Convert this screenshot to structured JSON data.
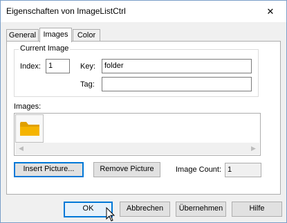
{
  "window": {
    "title": "Eigenschaften von ImageListCtrl",
    "close_glyph": "✕"
  },
  "tabs": [
    {
      "label": "General",
      "active": false
    },
    {
      "label": "Images",
      "active": true
    },
    {
      "label": "Color",
      "active": false
    }
  ],
  "current_image": {
    "group_label": "Current Image",
    "index_label": "Index:",
    "index_value": "1",
    "key_label": "Key:",
    "key_value": "folder",
    "tag_label": "Tag:",
    "tag_value": ""
  },
  "images": {
    "label": "Images:",
    "items": [
      {
        "icon": "folder-icon",
        "color": "#f5b400"
      }
    ],
    "scroll_left": "◀",
    "scroll_right": "▶"
  },
  "actions": {
    "insert_label": "Insert Picture...",
    "remove_label": "Remove Picture",
    "count_label": "Image Count:",
    "count_value": "1"
  },
  "footer": {
    "ok_label": "OK",
    "cancel_label": "Abbrechen",
    "apply_label": "Übernehmen",
    "help_label": "Hilfe"
  },
  "colors": {
    "accent": "#0078d7",
    "folder": "#f5b400"
  }
}
